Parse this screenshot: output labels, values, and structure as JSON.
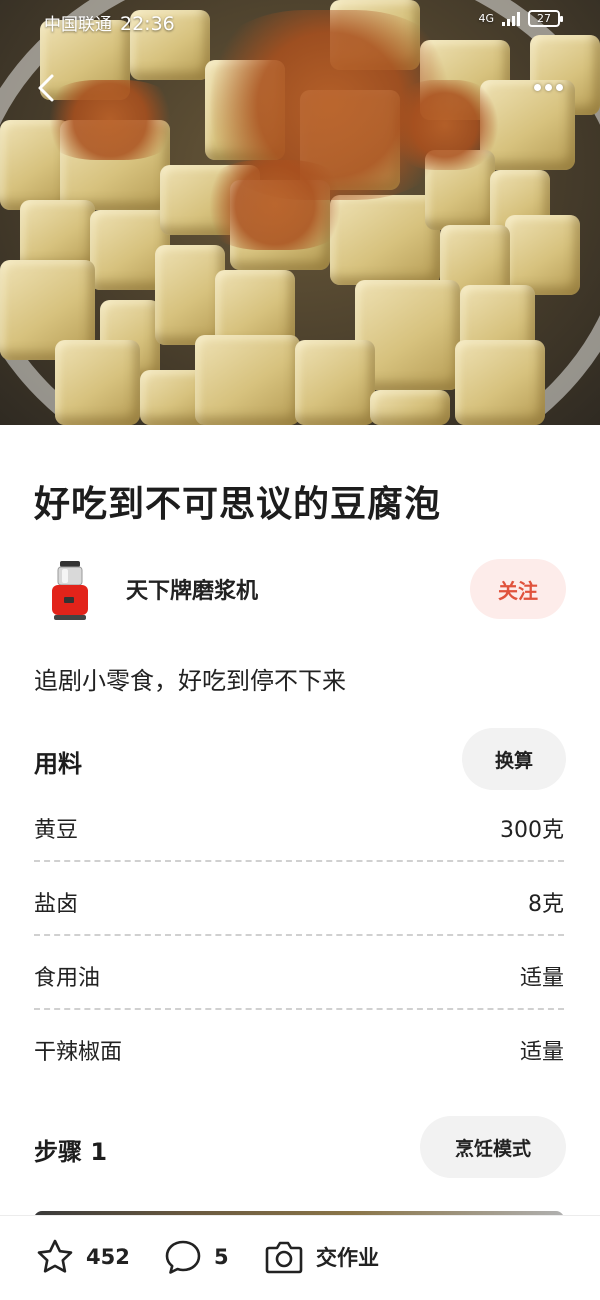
{
  "status_bar": {
    "carrier": "中国联通",
    "time": "22:36",
    "network": "4G",
    "battery": "27"
  },
  "recipe": {
    "title": "好吃到不可思议的豆腐泡",
    "author": "天下牌磨浆机",
    "follow_label": "关注",
    "description": "追剧小零食，好吃到停不下来"
  },
  "ingredients_section": {
    "title": "用料",
    "convert_label": "换算",
    "items": [
      {
        "name": "黄豆",
        "amount": "300克"
      },
      {
        "name": "盐卤",
        "amount": "8克"
      },
      {
        "name": "食用油",
        "amount": "适量"
      },
      {
        "name": "干辣椒面",
        "amount": "适量"
      }
    ]
  },
  "steps_section": {
    "title": "步骤 1",
    "cook_mode_label": "烹饪模式"
  },
  "bottom_bar": {
    "favorites_count": "452",
    "comments_count": "5",
    "homework_label": "交作业"
  },
  "colors": {
    "accent": "#e0533d",
    "accent_bg": "#fdecea",
    "pill_bg": "#f2f2f2"
  }
}
